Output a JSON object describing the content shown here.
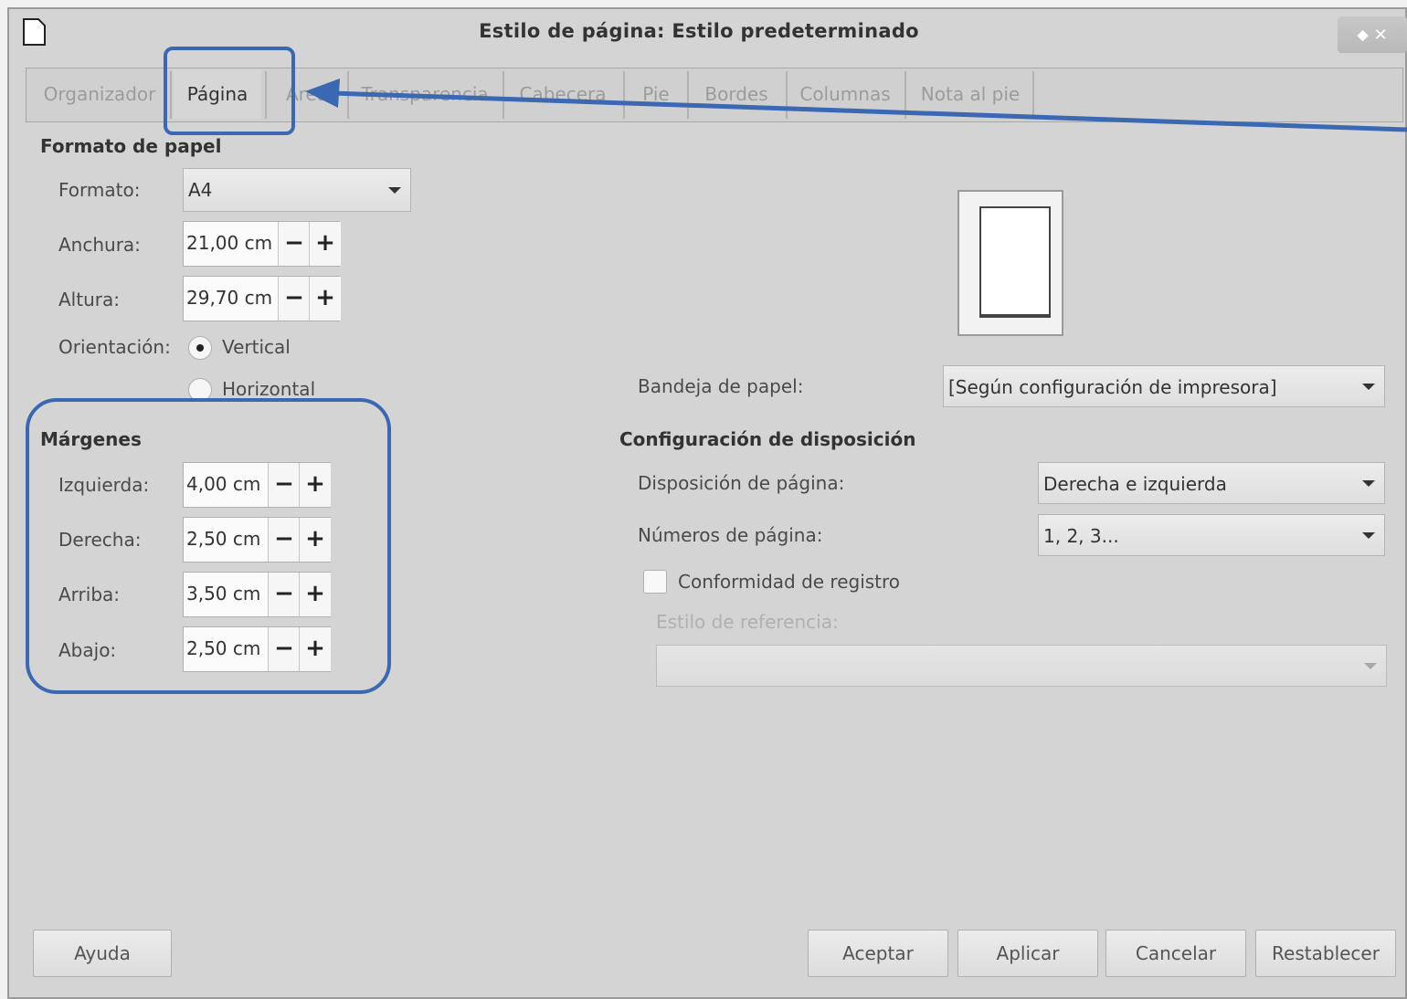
{
  "window": {
    "title": "Estilo de página: Estilo predeterminado",
    "controls": "⬥ ✕"
  },
  "tabs": [
    {
      "label": "Organizador",
      "active": false
    },
    {
      "label": "Página",
      "active": true
    },
    {
      "label": "Área",
      "active": false
    },
    {
      "label": "Transparencia",
      "active": false
    },
    {
      "label": "Cabecera",
      "active": false
    },
    {
      "label": "Pie",
      "active": false
    },
    {
      "label": "Bordes",
      "active": false
    },
    {
      "label": "Columnas",
      "active": false
    },
    {
      "label": "Nota al pie",
      "active": false
    }
  ],
  "paper_format": {
    "heading": "Formato de papel",
    "format_label": "Formato:",
    "format_value": "A4",
    "width_label": "Anchura:",
    "width_value": "21,00 cm",
    "height_label": "Altura:",
    "height_value": "29,70 cm",
    "orientation_label": "Orientación:",
    "orientation_vertical": "Vertical",
    "orientation_horizontal": "Horizontal",
    "orientation_selected": "Vertical"
  },
  "margins": {
    "heading": "Márgenes",
    "left_label": "Izquierda:",
    "left_value": "4,00 cm",
    "right_label": "Derecha:",
    "right_value": "2,50 cm",
    "top_label": "Arriba:",
    "top_value": "3,50 cm",
    "bottom_label": "Abajo:",
    "bottom_value": "2,50 cm"
  },
  "stepper": {
    "minus": "−",
    "plus": "+"
  },
  "paper_tray": {
    "label": "Bandeja de papel:",
    "value": "[Según configuración de impresora]"
  },
  "layout": {
    "heading": "Configuración de disposición",
    "page_layout_label": "Disposición de página:",
    "page_layout_value": "Derecha e izquierda",
    "page_numbers_label": "Números de página:",
    "page_numbers_value": "1, 2, 3...",
    "register_true_label": "Conformidad de registro",
    "register_true_checked": false,
    "reference_style_label": "Estilo de referencia:",
    "reference_style_value": ""
  },
  "buttons": {
    "help": "Ayuda",
    "ok": "Aceptar",
    "apply": "Aplicar",
    "cancel": "Cancelar",
    "reset": "Restablecer"
  },
  "colors": {
    "dialog_bg": "#d4d4d4",
    "annotation": "#3a68b2"
  }
}
